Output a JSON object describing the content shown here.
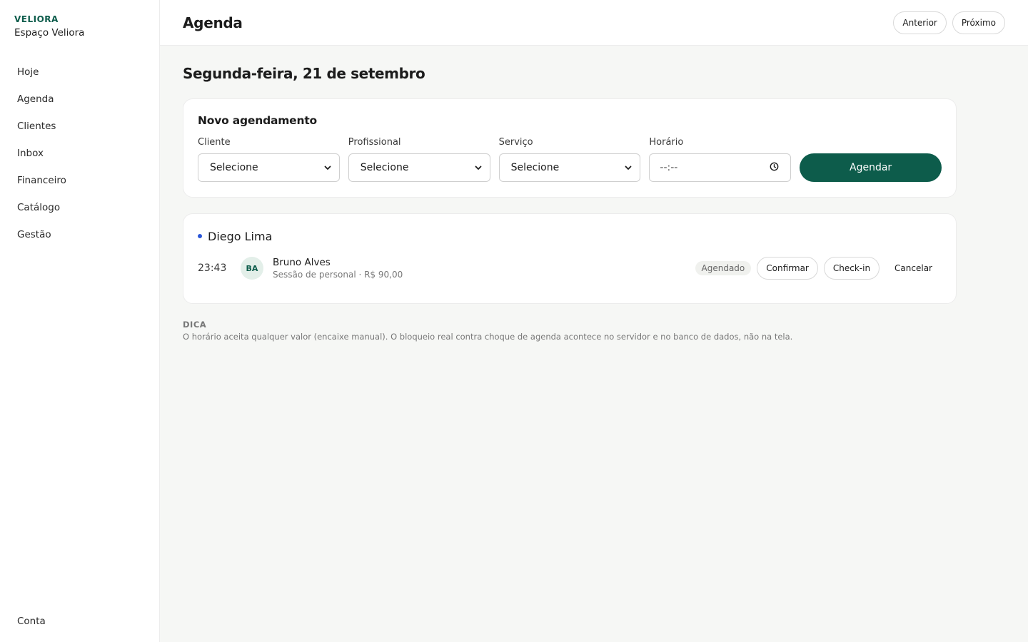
{
  "brand": {
    "mark": "VELIORA",
    "name": "Espaço Veliora"
  },
  "sidebar": {
    "items": [
      {
        "label": "Hoje"
      },
      {
        "label": "Agenda"
      },
      {
        "label": "Clientes"
      },
      {
        "label": "Inbox"
      },
      {
        "label": "Financeiro"
      },
      {
        "label": "Catálogo"
      },
      {
        "label": "Gestão"
      }
    ],
    "bottom": {
      "label": "Conta"
    }
  },
  "header": {
    "title": "Agenda",
    "prev_label": "Anterior",
    "next_label": "Próximo"
  },
  "date_heading": "Segunda-feira, 21 de setembro",
  "form": {
    "title": "Novo agendamento",
    "client": {
      "label": "Cliente",
      "value": "Selecione"
    },
    "professional": {
      "label": "Profissional",
      "value": "Selecione"
    },
    "service": {
      "label": "Serviço",
      "value": "Selecione"
    },
    "time": {
      "label": "Horário",
      "value": "--:--"
    },
    "submit_label": "Agendar"
  },
  "group": {
    "professional": "Diego Lima",
    "appointment": {
      "time": "23:43",
      "initials": "BA",
      "client": "Bruno Alves",
      "detail": "Sessão de personal · R$ 90,00",
      "status": "Agendado",
      "confirm_label": "Confirmar",
      "checkin_label": "Check-in",
      "cancel_label": "Cancelar"
    }
  },
  "tip": {
    "label": "DICA",
    "text": "O horário aceita qualquer valor (encaixe manual). O bloqueio real contra choque de agenda acontece no servidor e no banco de dados, não na tela."
  },
  "colors": {
    "accent": "#0d5c4b",
    "group_dot": "#2a56d8",
    "background": "#f6f7f5"
  }
}
